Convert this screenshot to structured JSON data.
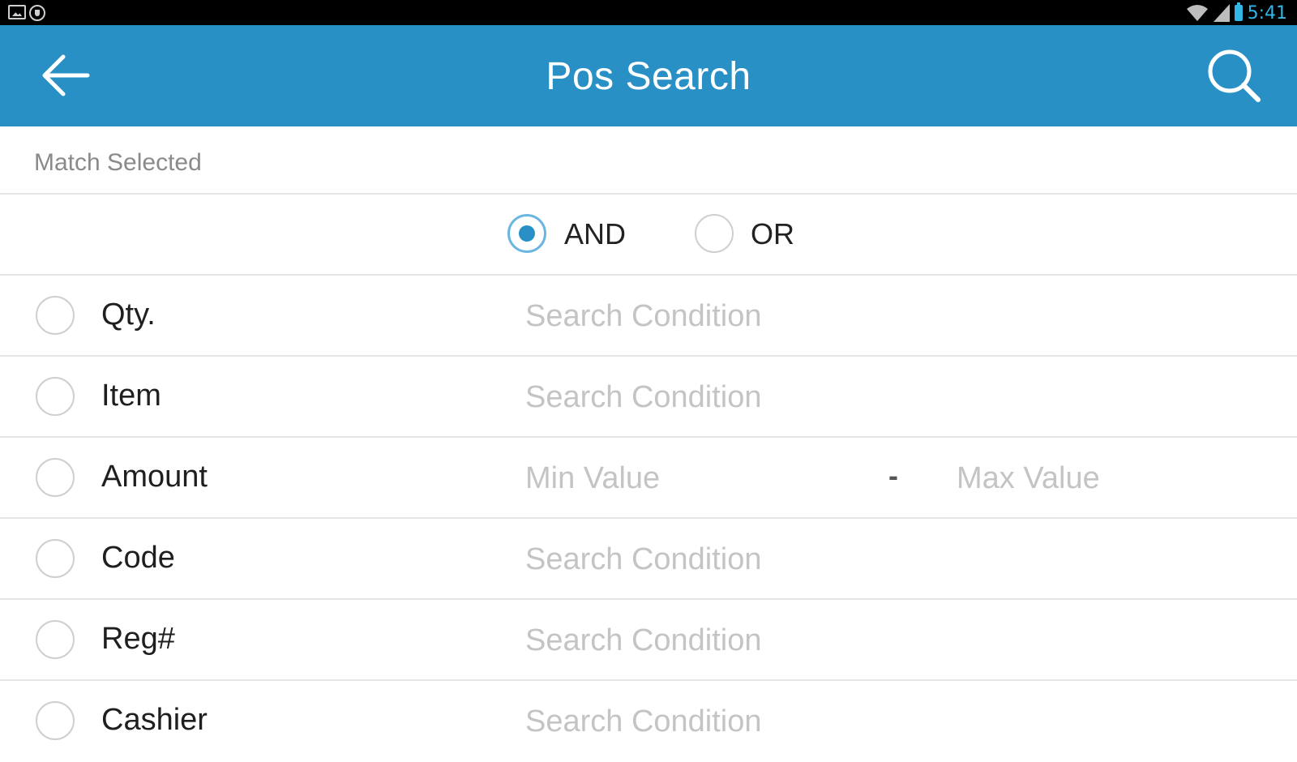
{
  "status_bar": {
    "time": "5:41",
    "left_icons": [
      "image-icon",
      "shield-icon"
    ],
    "right_icons": [
      "wifi-icon",
      "signal-icon",
      "battery-icon"
    ]
  },
  "app_bar": {
    "title": "Pos Search",
    "back_icon": "back-arrow-icon",
    "search_icon": "search-icon",
    "color": "#2990c6"
  },
  "match": {
    "header": "Match Selected",
    "options": [
      {
        "label": "AND",
        "selected": true
      },
      {
        "label": "OR",
        "selected": false
      }
    ]
  },
  "conditions": [
    {
      "label": "Qty.",
      "placeholder": "Search Condition",
      "checked": false
    },
    {
      "label": "Item",
      "placeholder": "Search Condition",
      "checked": false
    },
    {
      "label": "Amount",
      "min_placeholder": "Min Value",
      "separator": "-",
      "max_placeholder": "Max Value",
      "checked": false
    },
    {
      "label": "Code",
      "placeholder": "Search Condition",
      "checked": false
    },
    {
      "label": "Reg#",
      "placeholder": "Search Condition",
      "checked": false
    },
    {
      "label": "Cashier",
      "placeholder": "Search Condition",
      "checked": false
    }
  ]
}
